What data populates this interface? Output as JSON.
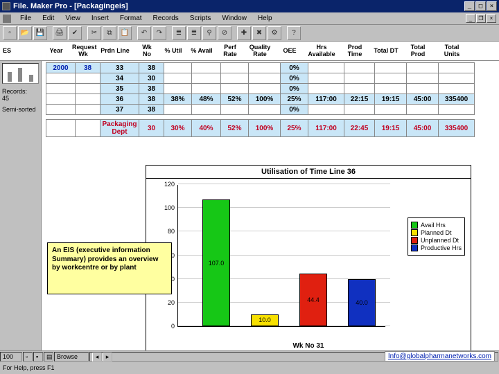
{
  "titlebar": {
    "title": "File. Maker Pro - [Packagingeis]"
  },
  "menu": {
    "items": [
      "File",
      "Edit",
      "View",
      "Insert",
      "Format",
      "Records",
      "Scripts",
      "Window",
      "Help"
    ]
  },
  "toolbar": {
    "icons": [
      "new-doc",
      "open",
      "save",
      "print",
      "print-preview",
      "",
      "cut",
      "copy",
      "paste",
      "",
      "undo",
      "redo",
      "",
      "sort-asc",
      "sort-desc",
      "find",
      "omit",
      "",
      "new-record",
      "delete-record",
      "",
      "script",
      "",
      "help"
    ]
  },
  "headers": {
    "leftval": "ES",
    "cols": [
      "Year",
      "Request\nWk",
      "Prdn Line",
      "Wk\nNo",
      "% Util",
      "% Avail",
      "Perf\nRate",
      "Quality\nRate",
      "OEE",
      "Hrs\nAvailable",
      "Prod\nTime",
      "Total DT",
      "Total\nProd",
      "Total\nUnits"
    ]
  },
  "leftpane": {
    "records_label": "Records:",
    "records_count": "45",
    "sort_label": "Semi-sorted"
  },
  "grid": {
    "col_widths": [
      "colY",
      "colW",
      "colP",
      "colWn",
      "colU",
      "colA",
      "colPr",
      "colQ",
      "colO",
      "colH",
      "colT",
      "colD",
      "colTP",
      "colTU"
    ],
    "rows": [
      [
        "2000",
        "38",
        "33",
        "38",
        "",
        "",
        "",
        "",
        "0%",
        "",
        "",
        "",
        "",
        ""
      ],
      [
        "",
        "",
        "34",
        "30",
        "",
        "",
        "",
        "",
        "0%",
        "",
        "",
        "",
        "",
        ""
      ],
      [
        "",
        "",
        "35",
        "38",
        "",
        "",
        "",
        "",
        "0%",
        "",
        "",
        "",
        "",
        ""
      ],
      [
        "",
        "",
        "36",
        "38",
        "38%",
        "48%",
        "52%",
        "100%",
        "25%",
        "117:00",
        "22:15",
        "19:15",
        "45:00",
        "335400"
      ],
      [
        "",
        "",
        "37",
        "38",
        "",
        "",
        "",
        "",
        "0%",
        "",
        "",
        "",
        "",
        ""
      ]
    ],
    "summary": [
      "",
      "",
      "Packaging Dept",
      "30",
      "30%",
      "40%",
      "52%",
      "100%",
      "25%",
      "117:00",
      "22:45",
      "19:15",
      "45:00",
      "335400"
    ]
  },
  "callout": {
    "text": "An EIS (executive information Summary) provides an overview by workcentre or by plant"
  },
  "chart": {
    "title": "Utilisation of Time Line 36",
    "xlabel": "Wk No 31",
    "legend": [
      "Avail Hrs",
      "Planned Dt",
      "Unplanned Dt",
      "Productive Hrs"
    ],
    "label0": "107.0",
    "label1": "10.0",
    "label2": "44.4",
    "label3": "40.0",
    "colors": [
      "#16c716",
      "#f7e000",
      "#e02010",
      "#1030c0"
    ]
  },
  "chart_data": {
    "type": "bar",
    "title": "Utilisation of Time Line 36",
    "xlabel": "Wk No 31",
    "ylabel": "",
    "ylim": [
      0,
      120
    ],
    "categories": [
      "Avail Hrs",
      "Planned Dt",
      "Unplanned Dt",
      "Productive Hrs"
    ],
    "values": [
      107.0,
      10.0,
      44.4,
      40.0
    ]
  },
  "status": {
    "zoom": "100",
    "mode": "Browse",
    "help": "For Help, press F1"
  },
  "email": {
    "text": "Info@globalpharmanetworks.com"
  }
}
